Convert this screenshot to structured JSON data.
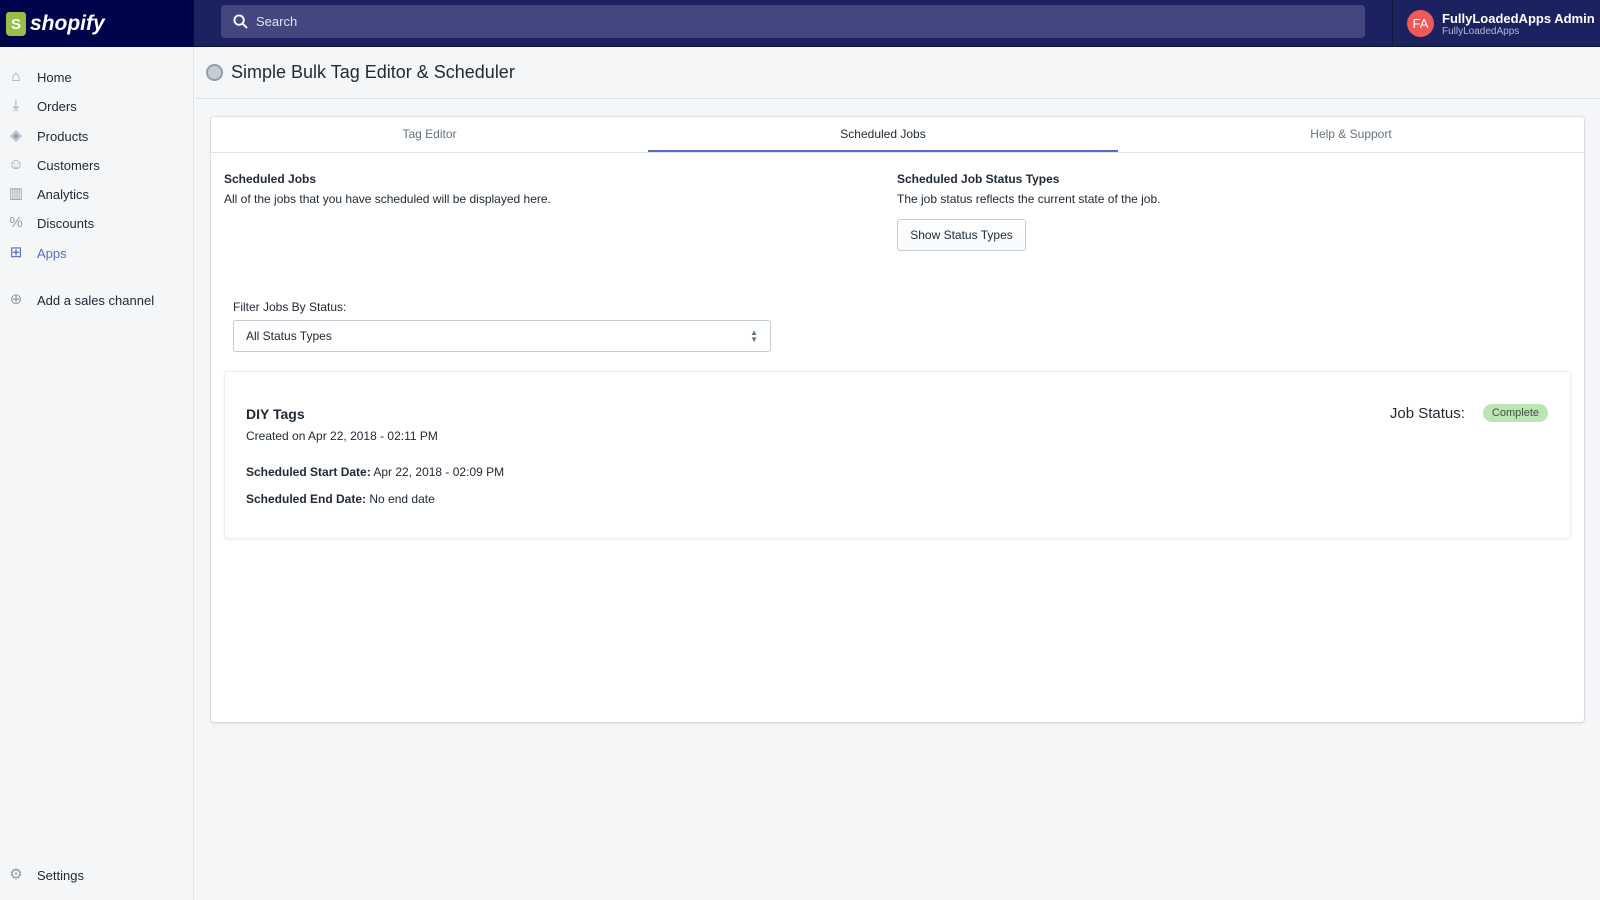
{
  "topbar": {
    "logo": "shopify",
    "search_placeholder": "Search",
    "user_initials": "FA",
    "user_name": "FullyLoadedApps Admin",
    "shop_name": "FullyLoadedApps"
  },
  "sidebar": {
    "items": [
      {
        "label": "Home",
        "icon": "home-icon"
      },
      {
        "label": "Orders",
        "icon": "orders-icon"
      },
      {
        "label": "Products",
        "icon": "tag-icon"
      },
      {
        "label": "Customers",
        "icon": "person-icon"
      },
      {
        "label": "Analytics",
        "icon": "chart-icon"
      },
      {
        "label": "Discounts",
        "icon": "discount-icon"
      },
      {
        "label": "Apps",
        "icon": "apps-icon"
      }
    ],
    "add_channel": "Add a sales channel",
    "settings": "Settings"
  },
  "header": {
    "title": "Simple Bulk Tag Editor & Scheduler"
  },
  "tabs": [
    "Tag Editor",
    "Scheduled Jobs",
    "Help & Support"
  ],
  "scheduled": {
    "title": "Scheduled Jobs",
    "desc": "All of the jobs that you have scheduled will be displayed here."
  },
  "status_types": {
    "title": "Scheduled Job Status Types",
    "desc": "The job status reflects the current state of the job.",
    "button": "Show Status Types"
  },
  "filter": {
    "label": "Filter Jobs By Status:",
    "value": "All Status Types"
  },
  "job": {
    "name": "DIY Tags",
    "created": "Created on Apr 22, 2018 - 02:11 PM",
    "start_label": "Scheduled Start Date:",
    "start_value": "Apr 22, 2018 - 02:09 PM",
    "end_label": "Scheduled End Date:",
    "end_value": "No end date",
    "status_label": "Job Status:",
    "status": "Complete"
  }
}
